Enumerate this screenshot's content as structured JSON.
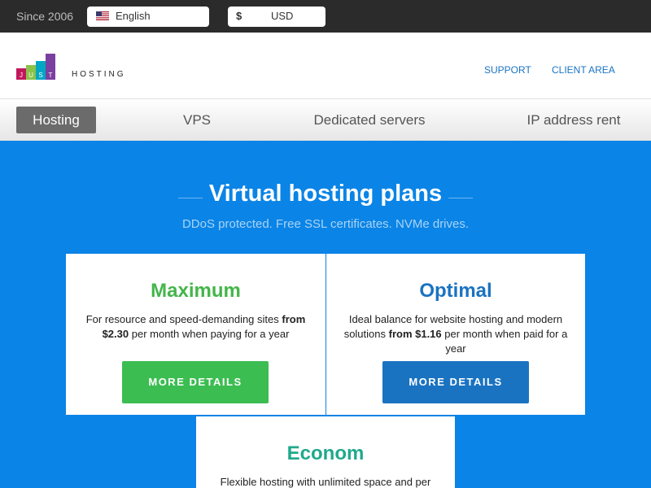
{
  "topbar": {
    "since": "Since 2006",
    "language": "English",
    "currency_symbol": "$",
    "currency": "USD"
  },
  "header": {
    "logo_letters": [
      "J",
      "U",
      "S",
      "T"
    ],
    "logo_text": "HOSTING",
    "links": [
      "SUPPORT",
      "CLIENT AREA"
    ]
  },
  "nav": {
    "items": [
      "Hosting",
      "VPS",
      "Dedicated servers",
      "IP address rent"
    ],
    "active": "Hosting"
  },
  "hero": {
    "title": "Virtual hosting plans",
    "subtitle": "DDoS protected. Free SSL certificates. NVMe drives."
  },
  "plans": [
    {
      "name": "Maximum",
      "color": "#44b54a",
      "desc_before": "For resource and speed-demanding sites ",
      "price": "from $2.30",
      "desc_after": " per month when paying for a year",
      "button": "MORE DETAILS",
      "button_color": "#3cbd52"
    },
    {
      "name": "Optimal",
      "color": "#1a73c1",
      "desc_before": "Ideal balance for website hosting and modern solutions ",
      "price": "from $1.16",
      "desc_after": " per month when paid for a year",
      "button": "MORE DETAILS",
      "button_color": "#1a73c1"
    },
    {
      "name": "Econom",
      "color": "#20a98c",
      "desc_before": "Flexible hosting with unlimited space and per",
      "price": "",
      "desc_after": "",
      "button": "",
      "button_color": ""
    }
  ]
}
